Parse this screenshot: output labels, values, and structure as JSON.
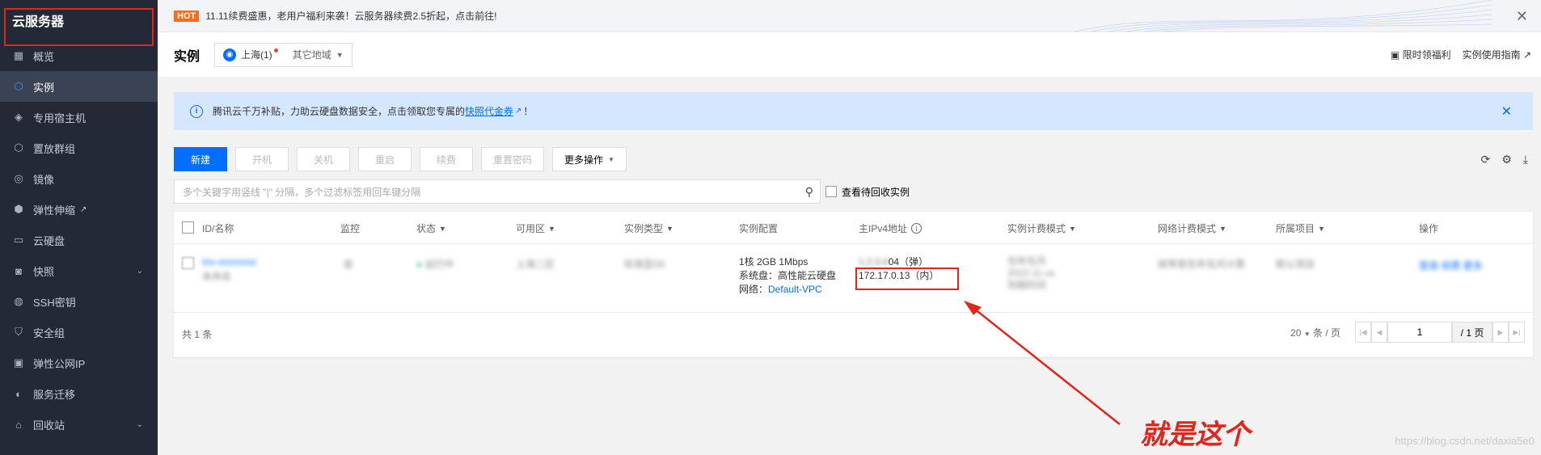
{
  "sidebar": {
    "title": "云服务器",
    "items": [
      {
        "label": "概览",
        "icon": "grid-icon",
        "ic": "▦"
      },
      {
        "label": "实例",
        "icon": "cube-icon",
        "ic": "⬡",
        "active": true
      },
      {
        "label": "专用宿主机",
        "icon": "layers-icon",
        "ic": "◈"
      },
      {
        "label": "置放群组",
        "icon": "group-icon",
        "ic": "⬡"
      },
      {
        "label": "镜像",
        "icon": "image-icon",
        "ic": "◎"
      },
      {
        "label": "弹性伸缩",
        "icon": "scale-icon",
        "ic": "⬢",
        "ext": "↗"
      },
      {
        "label": "云硬盘",
        "icon": "disk-icon",
        "ic": "▭"
      },
      {
        "label": "快照",
        "icon": "camera-icon",
        "ic": "◙",
        "caret": "⌄"
      },
      {
        "label": "SSH密钥",
        "icon": "key-icon",
        "ic": "◍"
      },
      {
        "label": "安全组",
        "icon": "shield-icon",
        "ic": "⛉"
      },
      {
        "label": "弹性公网IP",
        "icon": "ip-icon",
        "ic": "▣"
      },
      {
        "label": "服务迁移",
        "icon": "migrate-icon",
        "ic": "◐"
      },
      {
        "label": "回收站",
        "icon": "trash-icon",
        "ic": "⌂",
        "caret": "⌄"
      }
    ]
  },
  "topbar": {
    "hot": "HOT",
    "text": "11.11续费盛惠，老用户福利来袭！云服务器续费2.5折起，点击前往!"
  },
  "header": {
    "title": "实例",
    "region": "上海(1)",
    "other_region": "其它地域",
    "links": [
      "限时领福利",
      "实例使用指南"
    ]
  },
  "banner": {
    "text_before": "腾讯云千万补贴，力助云硬盘数据安全，点击领取您专属的",
    "link": "快照代金券",
    "text_after": "！"
  },
  "toolbar": {
    "new": "新建",
    "buttons": [
      "开机",
      "关机",
      "重启",
      "续费",
      "重置密码"
    ],
    "more": "更多操作"
  },
  "search": {
    "placeholder": "多个关键字用竖线 \"|\" 分隔，多个过滤标签用回车键分隔",
    "recycle_label": "查看待回收实例"
  },
  "table": {
    "headers": {
      "id": "ID/名称",
      "monitor": "监控",
      "status": "状态",
      "zone": "可用区",
      "type": "实例类型",
      "config": "实例配置",
      "ip": "主IPv4地址",
      "billing": "实例计费模式",
      "netbilling": "网络计费模式",
      "project": "所属项目",
      "ops": "操作"
    },
    "row": {
      "id": "ins-xxxxxxxx",
      "name": "未命名",
      "monitor": "",
      "status": "运行中",
      "zone": "上海二区",
      "type": "标准型S5",
      "config_line1": "1核 2GB 1Mbps",
      "config_line2": "系统盘：高性能云硬盘",
      "config_line3_label": "网络：",
      "config_line3_link": "Default-VPC",
      "ip_public": "1.░.░.░04（弹）",
      "ip_public_suffix": "04（弹）",
      "ip_private": "172.17.0.13（内）",
      "billing": "包年包月",
      "billing_date": "2022-11-xx",
      "billing_time": "到期时间",
      "netbilling": "按带宽包年包月计费",
      "project": "默认项目",
      "ops": "登录 续费 更多"
    },
    "total": "共 1 条",
    "page_size": "20",
    "per_page": "条 / 页",
    "page_current": "1",
    "page_total": "/ 1 页"
  },
  "annotation": {
    "text": "就是这个",
    "color": "#e1251b"
  },
  "watermark": "https://blog.csdn.net/daxia5e0",
  "colors": {
    "accent": "#006eff",
    "sidebar_bg": "#232936",
    "annotation": "#e1251b"
  }
}
